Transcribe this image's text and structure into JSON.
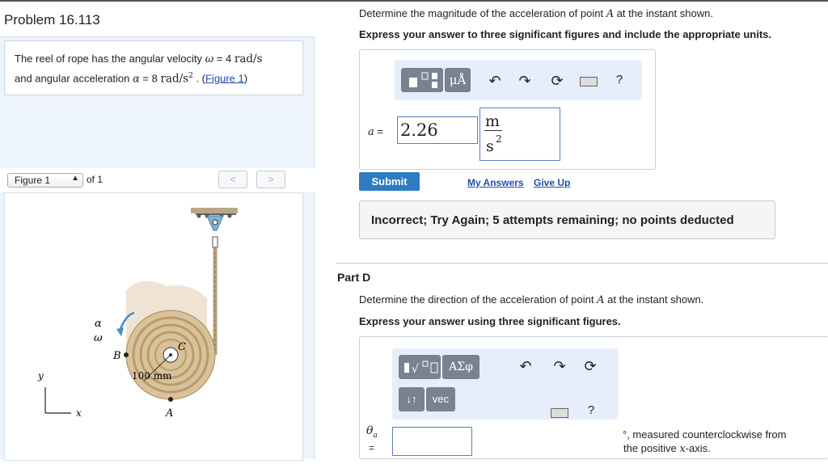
{
  "problem": {
    "title": "Problem 16.113",
    "statement_pre": "The reel of rope has the angular velocity ",
    "omega_sym": "ω",
    "eq1": " = 4 ",
    "omega_unit": "rad/s",
    "statement_mid": "and angular acceleration ",
    "alpha_sym": "α",
    "eq2": " = 8 ",
    "alpha_unit": "rad/s",
    "alpha_exp": "2",
    "statement_post": " . (",
    "figure_link": "Figure 1",
    "close": ")"
  },
  "figure_nav": {
    "select_value": "Figure 1",
    "of_label": "of 1",
    "prev": "<",
    "next": ">"
  },
  "figure": {
    "label_alpha": "α",
    "label_omega": "ω",
    "label_B": "B",
    "label_C": "C",
    "label_A": "A",
    "label_dim": "100 mm",
    "label_y": "y",
    "label_x": "x"
  },
  "part_c": {
    "question_pre": "Determine the magnitude of the acceleration of point ",
    "point": "A",
    "question_post": " at the instant shown.",
    "instruction": "Express your answer to three significant figures and include the appropriate units.",
    "toolbar": {
      "units_label": "μÅ",
      "help": "?"
    },
    "var_label": "a =",
    "var_sym": "a",
    "var_eq": " =",
    "value": "2.26",
    "unit_num": "m",
    "unit_den": "s",
    "unit_exp": "2",
    "submit": "Submit",
    "my_answers": "My Answers",
    "give_up": "Give Up",
    "feedback": "Incorrect; Try Again; 5 attempts remaining; no points deducted"
  },
  "part_d": {
    "heading": "Part D",
    "question_pre": "Determine the direction of the acceleration of point ",
    "point": "A",
    "question_post": " at the instant shown.",
    "instruction": "Express your answer using three significant figures.",
    "toolbar": {
      "greek_label": "ΑΣφ",
      "vec_label": "vec",
      "sort_label": "↓↑",
      "help": "?"
    },
    "theta_sym": "θ",
    "theta_sub": "a",
    "theta_eq": "=",
    "input_value": "",
    "suffix_line1": "°, measured counterclockwise from",
    "suffix_line2_pre": "the positive ",
    "suffix_axis": "x",
    "suffix_line2_post": "-axis."
  }
}
